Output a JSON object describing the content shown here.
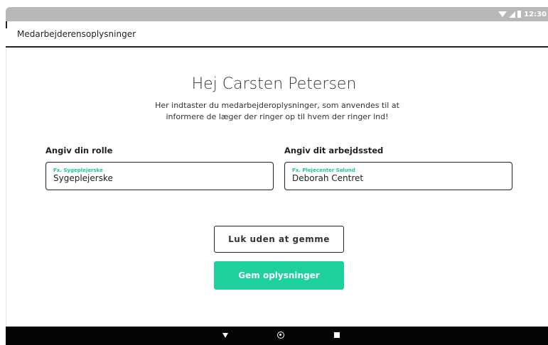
{
  "status_bar": {
    "time": "12:30"
  },
  "toolbar": {
    "title": "Medarbejderensoplysninger"
  },
  "main": {
    "greeting": "Hej Carsten Petersen",
    "intro": "Her indtaster du medarbejderoplysninger, som anvendes til at informere de læger der ringer op til hvem der ringer ind!"
  },
  "form": {
    "role": {
      "label": "Angiv din rolle",
      "hint": "Fx. Sygeplejerske",
      "value": "Sygeplejerske"
    },
    "workplace": {
      "label": "Angiv dit arbejdssted",
      "hint": "Fx. Plejecenter Sølund",
      "value": "Deborah Centret"
    }
  },
  "actions": {
    "close_label": "Luk uden at gemme",
    "save_label": "Gem oplysninger"
  },
  "colors": {
    "accent": "#1dd19f",
    "status_bar": "#b8b8b8",
    "nav_bar": "#050505"
  },
  "icons": [
    "wifi-icon",
    "signal-icon",
    "battery-icon",
    "back-icon",
    "home-icon",
    "recent-apps-icon"
  ]
}
